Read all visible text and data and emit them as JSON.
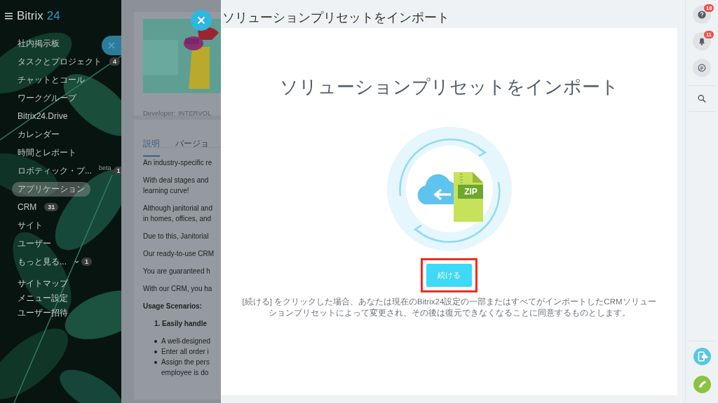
{
  "sidebar": {
    "logo": {
      "name": "Bitrix",
      "number": "24"
    },
    "items": [
      {
        "label": "社内掲示板",
        "selected": false
      },
      {
        "label": "タスクとプロジェクト",
        "badge": "4",
        "selected": false
      },
      {
        "label": "チャットとコール",
        "selected": false
      },
      {
        "label": "ワークグループ",
        "selected": false
      },
      {
        "label": "Bitrix24.Drive",
        "selected": false
      },
      {
        "label": "カレンダー",
        "selected": false
      },
      {
        "label": "時間とレポート",
        "selected": false
      },
      {
        "label": "ロボティック・プ...",
        "tag": "beta",
        "badge": "1",
        "selected": false
      },
      {
        "label": "アプリケーション",
        "selected": true
      },
      {
        "label": "CRM",
        "badge": "31",
        "selected": false
      },
      {
        "label": "サイト",
        "selected": false
      },
      {
        "label": "ユーザー",
        "selected": false
      },
      {
        "label": "もっと見る...",
        "badge": "1",
        "more": true,
        "selected": false
      }
    ],
    "footer_links": [
      "サイトマップ",
      "メニュー設定",
      "ユーザー招待"
    ]
  },
  "background_page": {
    "developer_label": "Developer:",
    "developer": "INTERVOL",
    "tabs": [
      {
        "label": "説明",
        "selected": true
      },
      {
        "label": "バージョ",
        "selected": false
      }
    ],
    "content": [
      {
        "kind": "paragraph",
        "lines": [
          "An industry-specific re"
        ]
      },
      {
        "kind": "paragraph",
        "lines": [
          "With deal stages and",
          "learning curve!"
        ]
      },
      {
        "kind": "paragraph",
        "lines": [
          "Although janitorial and",
          "in homes, offices, and"
        ]
      },
      {
        "kind": "paragraph",
        "lines": [
          "Due to this, Janitorial"
        ]
      },
      {
        "kind": "paragraph",
        "lines": [
          "Our ready-to-use CRM"
        ]
      },
      {
        "kind": "paragraph",
        "lines": [
          "You are guaranteed h"
        ]
      },
      {
        "kind": "paragraph",
        "lines": [
          "With our CRM, you ha"
        ]
      },
      {
        "kind": "heading",
        "lines": [
          "Usage Scenarios:"
        ]
      },
      {
        "kind": "numbered",
        "lines": [
          "1. Easily handle"
        ]
      },
      {
        "kind": "bullet",
        "lines": [
          "A well-designed"
        ]
      },
      {
        "kind": "bullet",
        "lines": [
          "Enter all order i"
        ]
      },
      {
        "kind": "bullet",
        "lines": [
          "Assign the pers",
          "employee is do"
        ]
      }
    ]
  },
  "panel": {
    "title": "ソリューションプリセットをインポート",
    "heading": "ソリューションプリセットをインポート",
    "file_label": "ZIP",
    "button": {
      "label": "続ける",
      "highlighted": true
    },
    "note": "[続ける] をクリックした場合、あなたは現在のBitrix24設定の一部またはすべてがインポートしたCRMソリューションプリセットによって変更され、その後は復元できなくなることに同意するものとします。"
  },
  "right_bar": {
    "top": [
      {
        "kind": "help",
        "badge": "18"
      },
      {
        "kind": "bell",
        "badge": "11"
      },
      {
        "kind": "chat"
      },
      {
        "kind": "search"
      }
    ],
    "bottom": [
      {
        "kind": "phone-cloud"
      },
      {
        "kind": "phone"
      }
    ]
  }
}
